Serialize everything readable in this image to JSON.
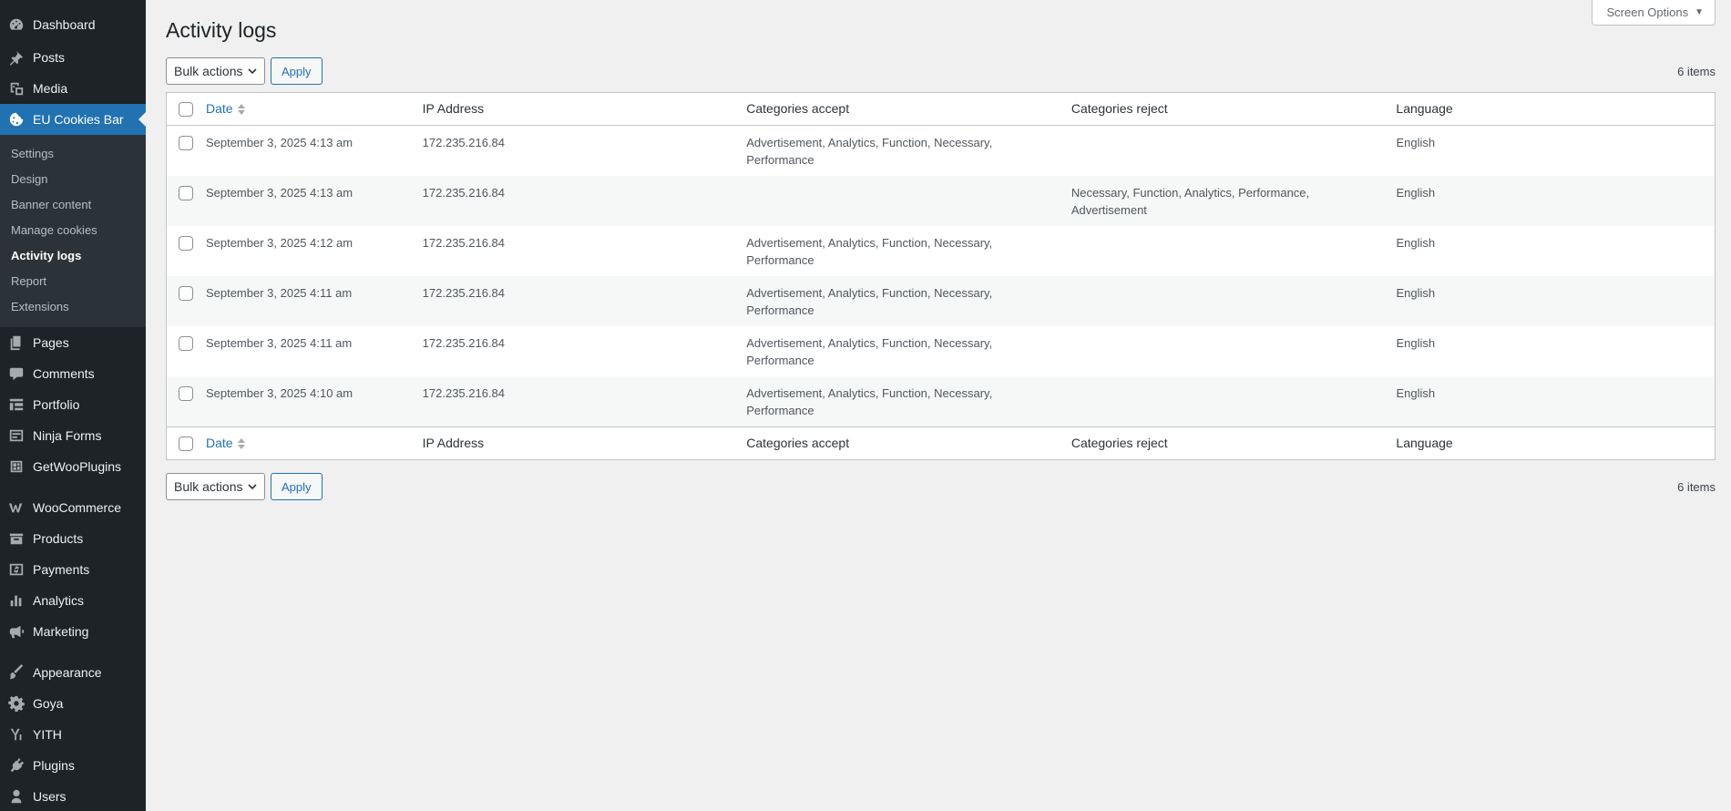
{
  "sidebar": {
    "top_items": [
      {
        "label": "Dashboard",
        "icon": "dashboard-icon"
      },
      {
        "label": "Posts",
        "icon": "pushpin-icon"
      },
      {
        "label": "Media",
        "icon": "media-icon"
      },
      {
        "label": "EU Cookies Bar",
        "icon": "cookie-icon"
      }
    ],
    "submenu": [
      {
        "label": "Settings"
      },
      {
        "label": "Design"
      },
      {
        "label": "Banner content"
      },
      {
        "label": "Manage cookies"
      },
      {
        "label": "Activity logs"
      },
      {
        "label": "Report"
      },
      {
        "label": "Extensions"
      }
    ],
    "mid_items": [
      {
        "label": "Pages",
        "icon": "pages-icon"
      },
      {
        "label": "Comments",
        "icon": "comments-icon"
      },
      {
        "label": "Portfolio",
        "icon": "portfolio-icon"
      },
      {
        "label": "Ninja Forms",
        "icon": "forms-icon"
      },
      {
        "label": "GetWooPlugins",
        "icon": "plugins-grid-icon"
      }
    ],
    "woo_items": [
      {
        "label": "WooCommerce",
        "icon": "woocommerce-icon"
      },
      {
        "label": "Products",
        "icon": "products-icon"
      },
      {
        "label": "Payments",
        "icon": "payments-icon"
      },
      {
        "label": "Analytics",
        "icon": "analytics-icon"
      },
      {
        "label": "Marketing",
        "icon": "megaphone-icon"
      }
    ],
    "bottom_items": [
      {
        "label": "Appearance",
        "icon": "paintbrush-icon"
      },
      {
        "label": "Goya",
        "icon": "gear-icon"
      },
      {
        "label": "YITH",
        "icon": "yith-icon"
      },
      {
        "label": "Plugins",
        "icon": "plug-icon"
      },
      {
        "label": "Users",
        "icon": "users-icon"
      }
    ]
  },
  "header": {
    "screen_options": "Screen Options",
    "title": "Activity logs"
  },
  "tablenav": {
    "bulk_label": "Bulk actions",
    "apply_label": "Apply",
    "count": "6 items"
  },
  "table": {
    "columns": {
      "date": "Date",
      "ip": "IP Address",
      "accept": "Categories accept",
      "reject": "Categories reject",
      "language": "Language"
    },
    "rows": [
      {
        "date": "September 3, 2025 4:13 am",
        "ip": "172.235.216.84",
        "accept": "Advertisement, Analytics, Function, Necessary, Performance",
        "reject": "",
        "language": "English"
      },
      {
        "date": "September 3, 2025 4:13 am",
        "ip": "172.235.216.84",
        "accept": "",
        "reject": "Necessary, Function, Analytics, Performance, Advertisement",
        "language": "English"
      },
      {
        "date": "September 3, 2025 4:12 am",
        "ip": "172.235.216.84",
        "accept": "Advertisement, Analytics, Function, Necessary, Performance",
        "reject": "",
        "language": "English"
      },
      {
        "date": "September 3, 2025 4:11 am",
        "ip": "172.235.216.84",
        "accept": "Advertisement, Analytics, Function, Necessary, Performance",
        "reject": "",
        "language": "English"
      },
      {
        "date": "September 3, 2025 4:11 am",
        "ip": "172.235.216.84",
        "accept": "Advertisement, Analytics, Function, Necessary, Performance",
        "reject": "",
        "language": "English"
      },
      {
        "date": "September 3, 2025 4:10 am",
        "ip": "172.235.216.84",
        "accept": "Advertisement, Analytics, Function, Necessary, Performance",
        "reject": "",
        "language": "English"
      }
    ]
  },
  "colors": {
    "sidebar_bg": "#1d2327",
    "submenu_bg": "#2c3338",
    "accent": "#2271b1",
    "page_bg": "#f0f0f1"
  }
}
